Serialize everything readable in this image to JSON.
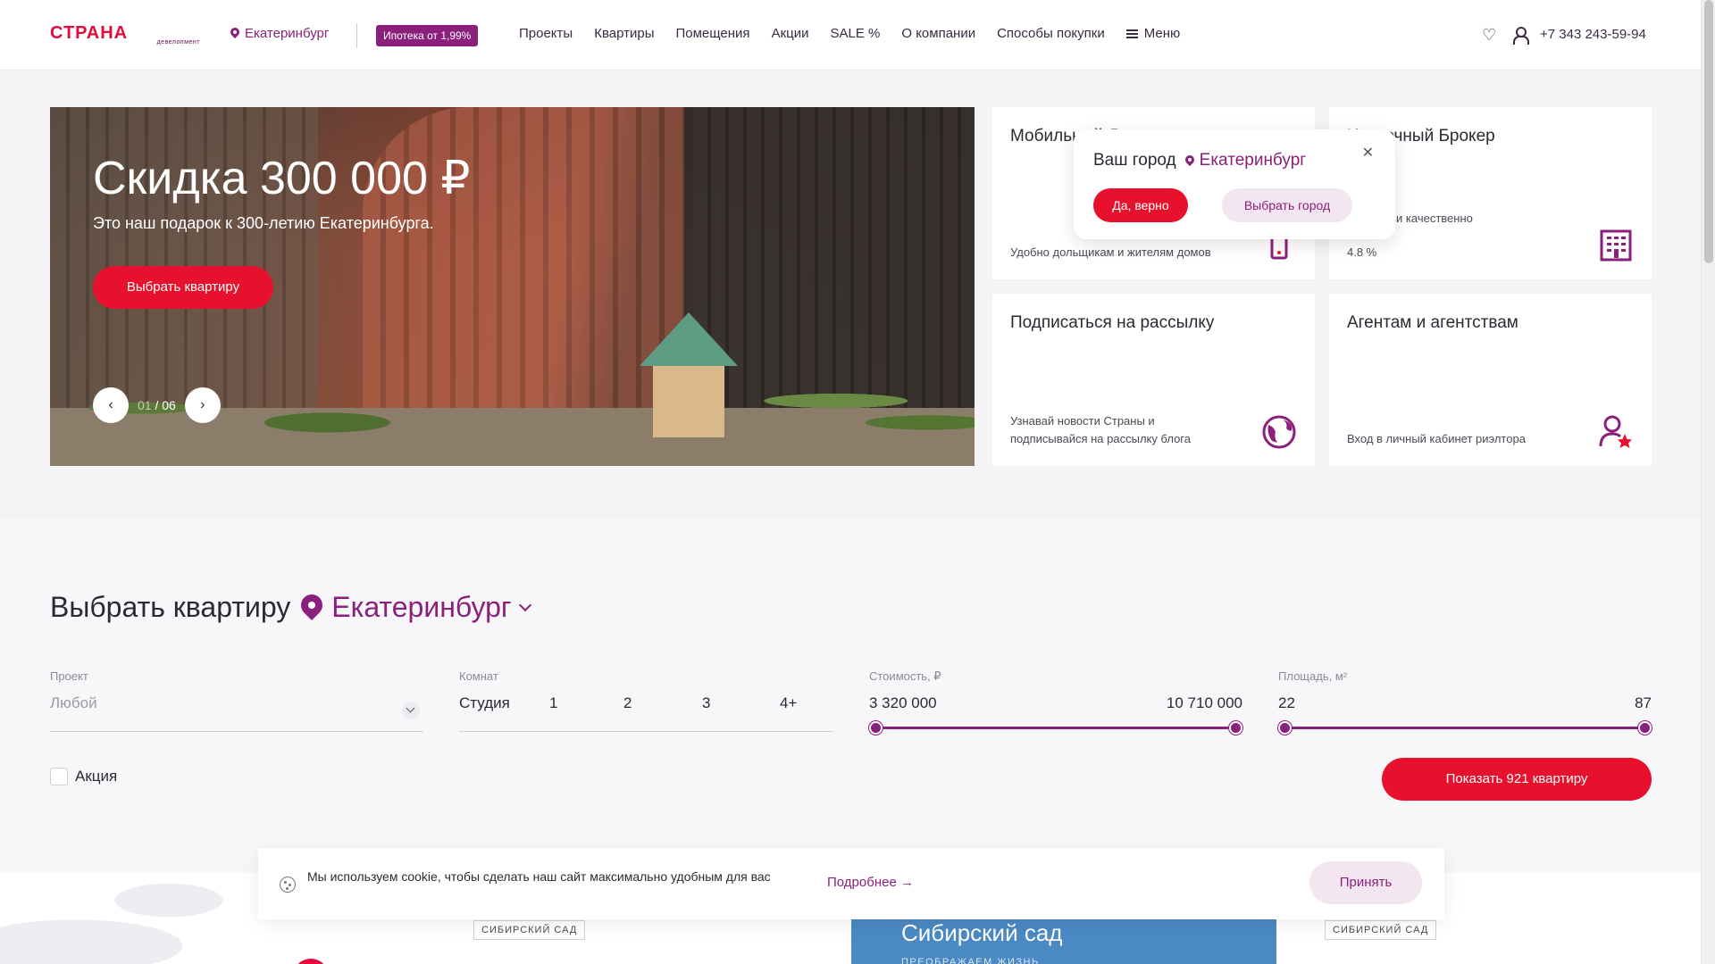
{
  "header": {
    "logo_text": "СТРАНА",
    "logo_sub": "девелопмент",
    "city": "Екатеринбург",
    "mortgage_badge": "Ипотека от 1,99%",
    "nav": [
      "Проекты",
      "Квартиры",
      "Помещения",
      "Акции",
      "SALE %",
      "О компании",
      "Способы покупки"
    ],
    "menu_label": "Меню",
    "phone": "+7 343 243-59-94"
  },
  "hero": {
    "title": "Скидка 300 000 ₽",
    "subtitle": "Это наш подарок к 300-летию Екатеринбурга.",
    "button": "Выбрать квартиру",
    "current": "01",
    "total": "/ 06"
  },
  "cards": [
    {
      "title": "Мобильный Девелопер",
      "desc": "Удобно дольщикам и жителям домов"
    },
    {
      "title": "Ипотечный Брокер",
      "desc": "Выгодно и качественно",
      "extra": "4.8 %"
    },
    {
      "title": "Подписаться на рассылку",
      "desc": "Узнавай новости Страны и подписывайся на рассылку блога"
    },
    {
      "title": "Агентам и агентствам",
      "desc": "Вход в личный кабинет риэлтора"
    }
  ],
  "city_popup": {
    "question": "Ваш город",
    "city": "Екатеринбург",
    "yes": "Да, верно",
    "choose": "Выбрать город"
  },
  "filter": {
    "title": "Выбрать квартиру",
    "city": "Екатеринбург",
    "project_label": "Проект",
    "project_value": "Любой",
    "rooms_label": "Комнат",
    "rooms": [
      "Студия",
      "1",
      "2",
      "3",
      "4+"
    ],
    "price_label": "Стоимость, ₽",
    "price_min": "3 320 000",
    "price_max": "10 710 000",
    "area_label": "Площадь, м²",
    "area_min": "22",
    "area_max": "87",
    "promo_label": "Акция",
    "show_button": "Показать 921 квартиру"
  },
  "bottom": {
    "tag1": "СИБИРСКИЙ САД",
    "tag2": "СИБИРСКИЙ САД",
    "promo_title": "Сибирский сад",
    "promo_sub": "ПРЕОБРАЖАЕМ ЖИЗНЬ"
  },
  "cookie": {
    "text": "Мы используем cookie, чтобы сделать наш сайт максимально удобным для вас",
    "more": "Подробнее →",
    "accept": "Принять"
  }
}
